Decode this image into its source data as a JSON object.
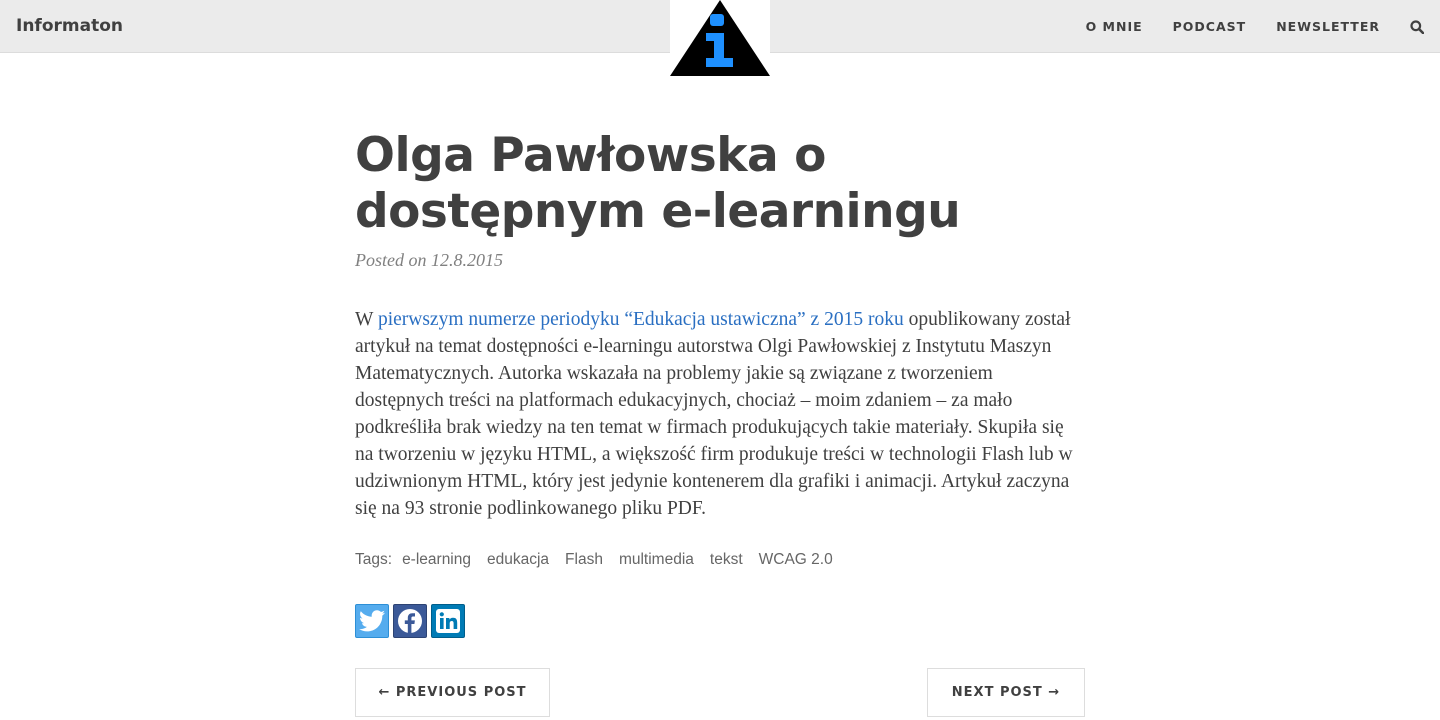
{
  "navbar": {
    "brand": "Informaton",
    "links": [
      "O MNIE",
      "PODCAST",
      "NEWSLETTER"
    ],
    "search_icon": "search-icon"
  },
  "logo": {
    "icon": "info-triangle-logo",
    "colors": {
      "triangle": "#000000",
      "glyph": "#1e90ff"
    }
  },
  "post": {
    "title": "Olga Pawłowska o dostępnym e-learningu",
    "meta": "Posted on 12.8.2015",
    "body": {
      "lead": "W ",
      "link_text": "pierwszym numerze periodyku “Edukacja ustawiczna” z 2015 roku",
      "rest": " opublikowany został artykuł na temat dostępności e-learningu autorstwa Olgi Pawłowskiej z Instytutu Maszyn Matematycznych. Autorka wskazała na problemy jakie są związane z tworzeniem dostępnych treści na platformach edukacyjnych, chociaż – moim zdaniem – za mało podkreśliła brak wiedzy na ten temat w firmach produkujących takie materiały. Skupiła się na tworzeniu w języku HTML, a większość firm produkuje treści w technologii Flash lub w udziwnionym HTML, który jest jedynie kontenerem dla grafiki i animacji. Artykuł zaczyna się na 93 stronie podlinkowanego pliku PDF."
    },
    "tags_label": "Tags:",
    "tags": [
      "e-learning",
      "edukacja",
      "Flash",
      "multimedia",
      "tekst",
      "WCAG 2.0"
    ]
  },
  "share": {
    "twitter": "twitter-icon",
    "facebook": "facebook-icon",
    "linkedin": "linkedin-icon",
    "colors": {
      "twitter": "#55acee",
      "facebook": "#3b5998",
      "linkedin": "#007bb5"
    }
  },
  "pager": {
    "prev": "← PREVIOUS POST",
    "next": "NEXT POST →"
  },
  "colors": {
    "navbar_bg": "#ebebeb",
    "text": "#404040",
    "link": "#2a6fc2",
    "meta": "#808080"
  }
}
